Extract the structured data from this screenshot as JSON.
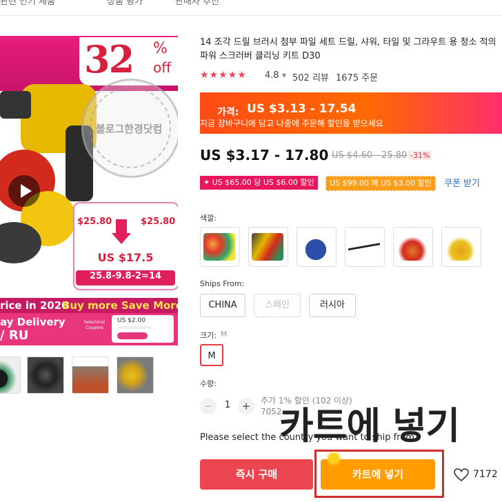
{
  "top_tabs": [
    "관련 인기 제품",
    "상품 평가",
    "판매자 추천"
  ],
  "image": {
    "discount_number": "32",
    "discount_pct": "%",
    "discount_off": "off",
    "watermark": "블로그한경닷컴",
    "price_left": "$25.80",
    "price_right": "$25.80",
    "price_big": "US $17.5",
    "formula": "25.8-9.8-2=14",
    "promo_prefix": "rice in 2020",
    "promo_text": "Buy more Save More",
    "delivery": "ay Delivery",
    "region": "/ RU",
    "coupon_price": "US $2.00",
    "coupon_badge": "Selectoral Coupons"
  },
  "title": "14 조각 드릴 브러시 첨부 파일 세트 드릴, 샤워, 타일 및 그라우트 용 청소 적의 파워 스크러버 클리닝 키트 D30",
  "rating": {
    "stars": "★★★★★",
    "score": "4.8",
    "reviews": "502 리뷰",
    "orders": "1675 주문"
  },
  "promo_banner": {
    "label": "가격:",
    "price": "US $3.13 - 17.54",
    "sub": "지금 장바구니에 담고 나중에 주문해 할인을 받으세요"
  },
  "price": {
    "current": "US $3.17 - 17.80",
    "original": "US $4.60 - 25.80",
    "discount": "-31%"
  },
  "coupons": {
    "first": "✦ US $65.00 당 US $6.00 할인",
    "second": "US $99.00 에 US $3.00 할인",
    "link": "쿠폰 받기"
  },
  "color_label": "색깔:",
  "swatch_colors": [
    "#f2a23a",
    "#3a3a3a",
    "#2c4da8",
    "#ffffff",
    "#e07a2a",
    "#e8a21e"
  ],
  "ships_from": {
    "label": "Ships From:",
    "options": [
      "CHINA",
      "스페인",
      "러시아"
    ]
  },
  "size": {
    "label": "크기:",
    "selected_hint": "M",
    "option": "M"
  },
  "quantity": {
    "label": "수량:",
    "minus": "−",
    "value": "1",
    "plus": "+",
    "available_line1": "추가 1% 할인 (102 이상)",
    "available_line2": "7052"
  },
  "overlay_caption": "카트에 넣기",
  "warning": "Please select the country you want to ship from",
  "buttons": {
    "buy_now": "즉시 구매",
    "add_cart": "카트에 넣기",
    "wishlist_count": "7172"
  }
}
